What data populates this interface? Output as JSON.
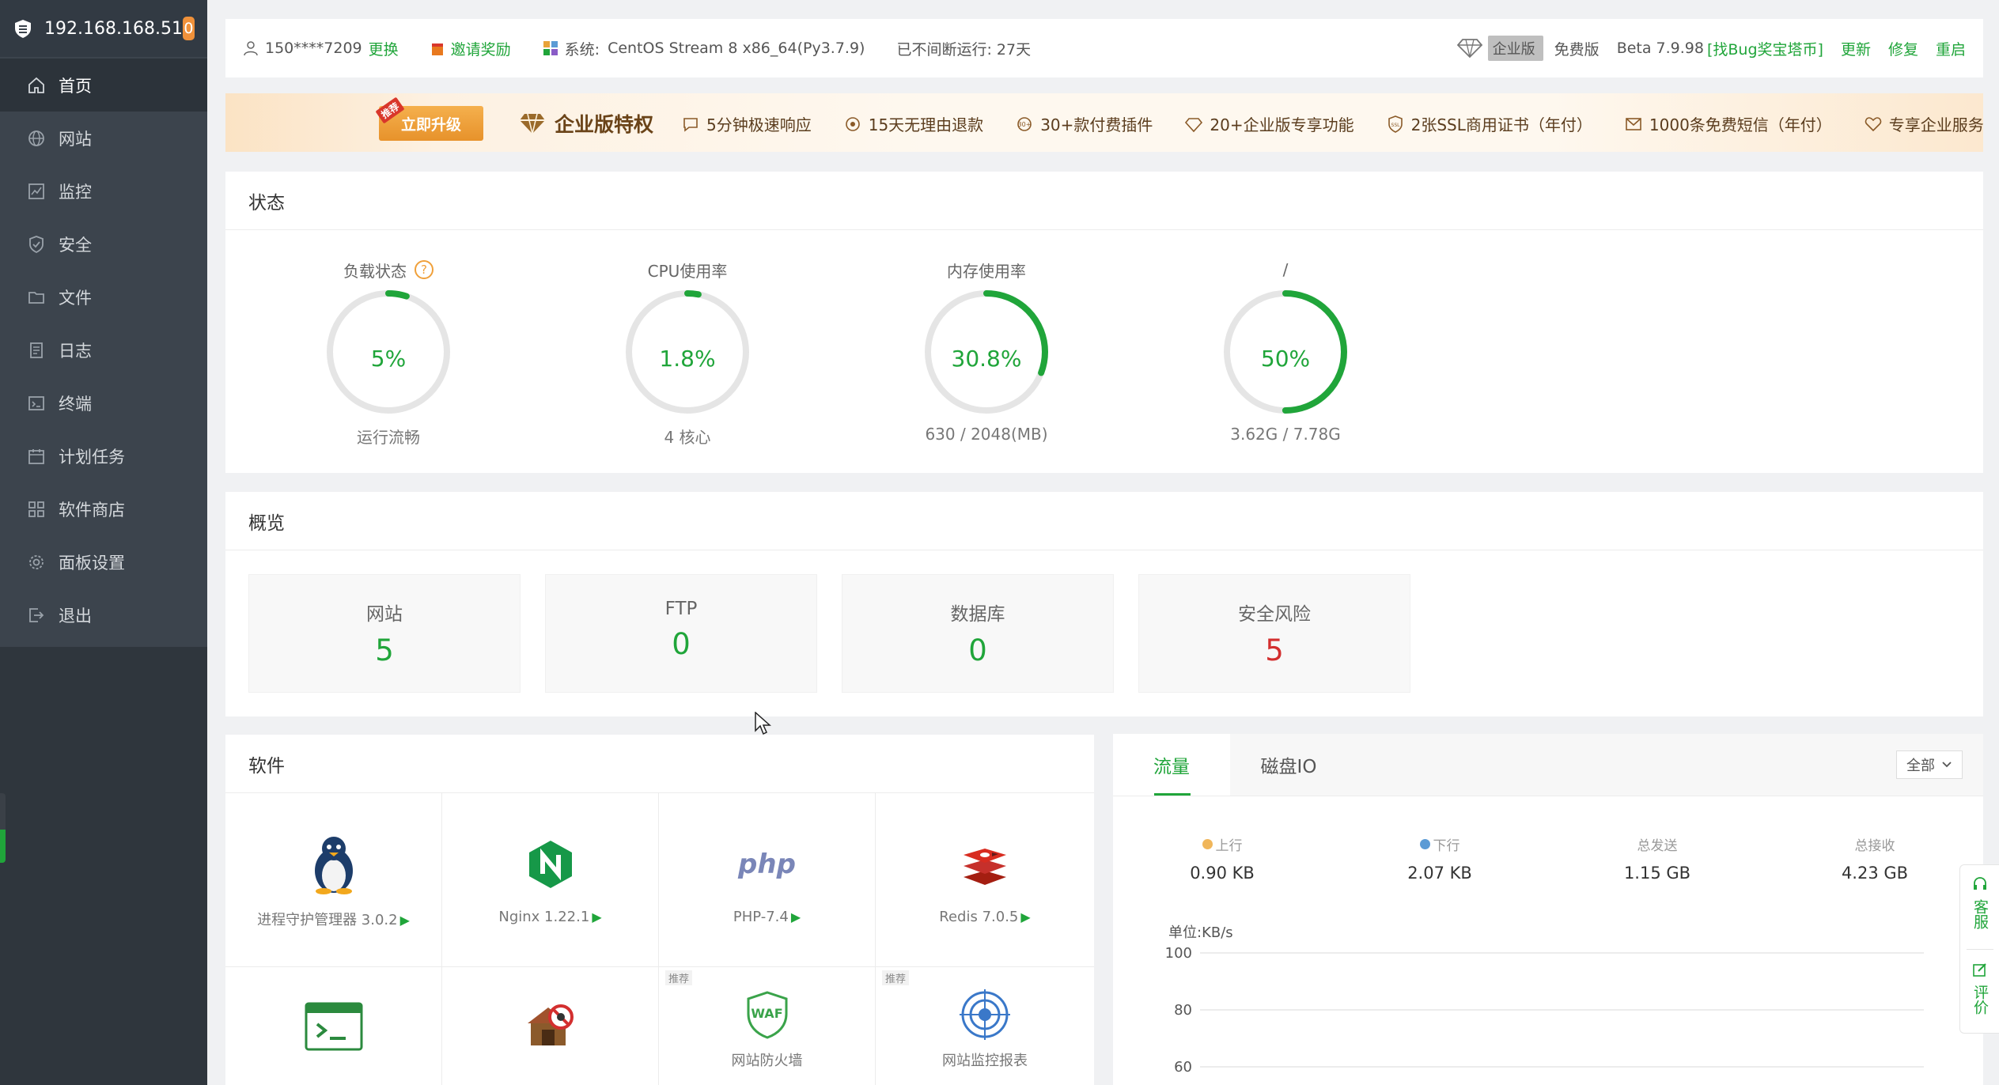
{
  "sidebar": {
    "ip": "192.168.168.51",
    "badge": "0",
    "items": [
      {
        "label": "首页"
      },
      {
        "label": "网站"
      },
      {
        "label": "监控"
      },
      {
        "label": "安全"
      },
      {
        "label": "文件"
      },
      {
        "label": "日志"
      },
      {
        "label": "终端"
      },
      {
        "label": "计划任务"
      },
      {
        "label": "软件商店"
      },
      {
        "label": "面板设置"
      },
      {
        "label": "退出"
      }
    ]
  },
  "topbar": {
    "user": "150****7209",
    "change": "更换",
    "invite": "邀请奖励",
    "system_label": "系统:",
    "system_value": "CentOS Stream 8 x86_64(Py3.7.9)",
    "uptime": "已不间断运行: 27天",
    "edition": "企业版",
    "free": "免费版",
    "version": "Beta 7.9.98",
    "bug_bounty": "[找Bug奖宝塔币]",
    "update": "更新",
    "repair": "修复",
    "restart": "重启"
  },
  "banner": {
    "upgrade_tag": "推荐",
    "upgrade_btn": "立即升级",
    "title": "企业版特权",
    "perks": [
      "5分钟极速响应",
      "15天无理由退款",
      "30+款付费插件",
      "20+企业版专享功能",
      "2张SSL商用证书（年付）",
      "1000条免费短信（年付）",
      "专享企业服务群"
    ]
  },
  "status": {
    "title": "状态",
    "gauges": [
      {
        "label": "负载状态",
        "value": "5%",
        "percent": 5,
        "sub": "运行流畅",
        "help": "?"
      },
      {
        "label": "CPU使用率",
        "value": "1.8%",
        "percent": 1.8,
        "sub": "4 核心"
      },
      {
        "label": "内存使用率",
        "value": "30.8%",
        "percent": 30.8,
        "sub": "630 / 2048(MB)"
      },
      {
        "label": "/",
        "value": "50%",
        "percent": 50,
        "sub": "3.62G / 7.78G"
      }
    ]
  },
  "overview": {
    "title": "概览",
    "cards": [
      {
        "label": "网站",
        "value": "5"
      },
      {
        "label": "FTP",
        "value": "0"
      },
      {
        "label": "数据库",
        "value": "0"
      },
      {
        "label": "安全风险",
        "value": "5"
      }
    ]
  },
  "software": {
    "title": "软件",
    "items": [
      {
        "name": "进程守护管理器 3.0.2",
        "icon": "linux-penguin-icon"
      },
      {
        "name": "Nginx 1.22.1",
        "icon": "nginx-icon"
      },
      {
        "name": "PHP-7.4",
        "icon": "php-icon",
        "icon_text": "php"
      },
      {
        "name": "Redis 7.0.5",
        "icon": "redis-icon"
      },
      {
        "name": "",
        "icon": "terminal-icon"
      },
      {
        "name": "",
        "icon": "anti-spider-icon"
      },
      {
        "name": "网站防火墙",
        "icon": "waf-icon",
        "tag": "推荐",
        "icon_text": "WAF"
      },
      {
        "name": "网站监控报表",
        "icon": "monitor-report-icon",
        "tag": "推荐"
      }
    ]
  },
  "traffic": {
    "tabs": [
      "流量",
      "磁盘IO"
    ],
    "select_value": "全部",
    "stats": [
      {
        "label": "上行",
        "value": "0.90 KB",
        "color": "#f0b65a"
      },
      {
        "label": "下行",
        "value": "2.07 KB",
        "color": "#5b9bd5"
      },
      {
        "label": "总发送",
        "value": "1.15 GB"
      },
      {
        "label": "总接收",
        "value": "4.23 GB"
      }
    ],
    "chart_unit": "单位:KB/s"
  },
  "chart_data": {
    "type": "line",
    "title": "",
    "ylabel": "单位:KB/s",
    "y_ticks": [
      100,
      80,
      60
    ],
    "series": []
  },
  "side_float": {
    "service": "客服",
    "review": "评价"
  },
  "colors": {
    "accent": "#20a53a",
    "danger": "#d32f2f",
    "sidebar": "#3c444d",
    "gauge_track": "#e5e5e5"
  }
}
